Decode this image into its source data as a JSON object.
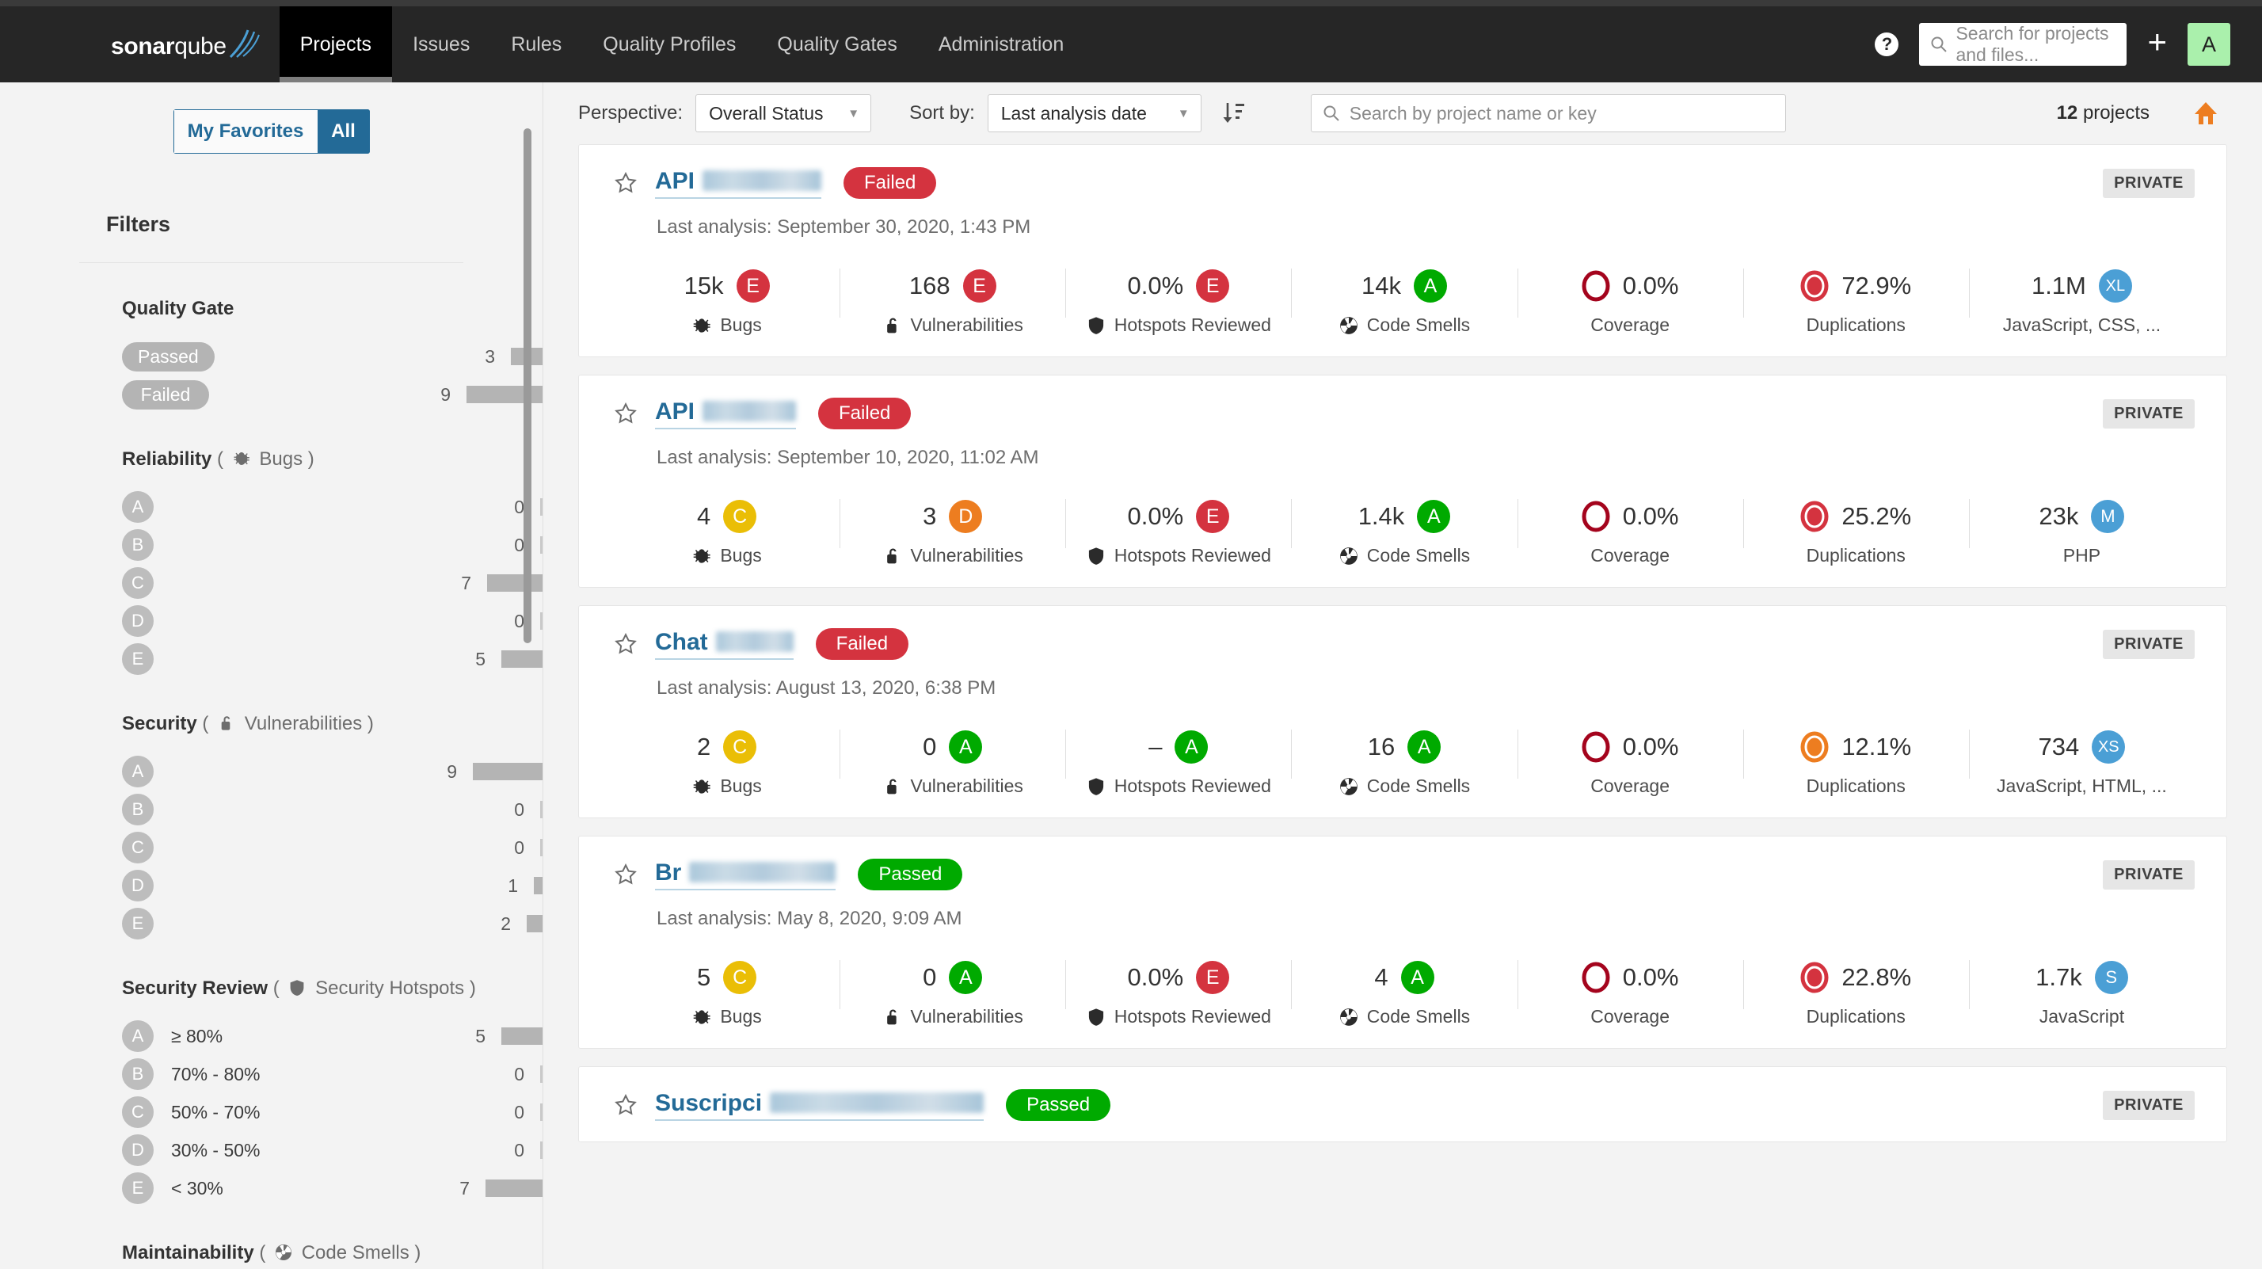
{
  "navbar": {
    "brand_bold": "sonar",
    "brand_light": "qube",
    "items": [
      {
        "label": "Projects",
        "active": true
      },
      {
        "label": "Issues",
        "active": false
      },
      {
        "label": "Rules",
        "active": false
      },
      {
        "label": "Quality Profiles",
        "active": false
      },
      {
        "label": "Quality Gates",
        "active": false
      },
      {
        "label": "Administration",
        "active": false
      }
    ],
    "help_label": "?",
    "search_placeholder": "Search for projects and files...",
    "plus_label": "+",
    "avatar_initial": "A"
  },
  "sidebar": {
    "favorites_label": "My Favorites",
    "all_label": "All",
    "filters_title": "Filters",
    "groups": [
      {
        "title": "Quality Gate",
        "sub": "",
        "icon": "",
        "type": "pill",
        "rows": [
          {
            "pill": "Passed",
            "count": "3",
            "bar": 40
          },
          {
            "pill": "Failed",
            "count": "9",
            "bar": 96
          }
        ]
      },
      {
        "title": "Reliability",
        "sub": "Bugs",
        "icon": "bug-icon",
        "type": "rating",
        "rows": [
          {
            "rating": "A",
            "label": "",
            "count": "0",
            "bar": 0
          },
          {
            "rating": "B",
            "label": "",
            "count": "0",
            "bar": 0
          },
          {
            "rating": "C",
            "label": "",
            "count": "7",
            "bar": 70
          },
          {
            "rating": "D",
            "label": "",
            "count": "0",
            "bar": 0
          },
          {
            "rating": "E",
            "label": "",
            "count": "5",
            "bar": 52
          }
        ]
      },
      {
        "title": "Security",
        "sub": "Vulnerabilities",
        "icon": "lock-icon",
        "type": "rating",
        "rows": [
          {
            "rating": "A",
            "label": "",
            "count": "9",
            "bar": 88
          },
          {
            "rating": "B",
            "label": "",
            "count": "0",
            "bar": 0
          },
          {
            "rating": "C",
            "label": "",
            "count": "0",
            "bar": 0
          },
          {
            "rating": "D",
            "label": "",
            "count": "1",
            "bar": 11
          },
          {
            "rating": "E",
            "label": "",
            "count": "2",
            "bar": 20
          }
        ]
      },
      {
        "title": "Security Review",
        "sub": "Security Hotspots",
        "icon": "shield-icon",
        "type": "rating",
        "rows": [
          {
            "rating": "A",
            "label": "≥ 80%",
            "count": "5",
            "bar": 52
          },
          {
            "rating": "B",
            "label": "70% - 80%",
            "count": "0",
            "bar": 0
          },
          {
            "rating": "C",
            "label": "50% - 70%",
            "count": "0",
            "bar": 0
          },
          {
            "rating": "D",
            "label": "30% - 50%",
            "count": "0",
            "bar": 0
          },
          {
            "rating": "E",
            "label": "< 30%",
            "count": "7",
            "bar": 72
          }
        ]
      },
      {
        "title": "Maintainability",
        "sub": "Code Smells",
        "icon": "code-smell-icon",
        "type": "rating",
        "rows": []
      }
    ]
  },
  "toolbar": {
    "perspective_label": "Perspective:",
    "perspective_value": "Overall Status",
    "sort_label": "Sort by:",
    "sort_value": "Last analysis date",
    "search_placeholder": "Search by project name or key",
    "count_number": "12",
    "count_word": "projects"
  },
  "cards": [
    {
      "name": "API",
      "redacted_width": 150,
      "status": "Failed",
      "status_kind": "failed",
      "visibility": "PRIVATE",
      "last_analysis": "Last analysis: September 30, 2020, 1:43 PM",
      "metrics": [
        {
          "value": "15k",
          "rating": "E",
          "color": "#d4333f",
          "label": "Bugs",
          "icon": "bug-icon"
        },
        {
          "value": "168",
          "rating": "E",
          "color": "#d4333f",
          "label": "Vulnerabilities",
          "icon": "lock-icon"
        },
        {
          "value": "0.0%",
          "rating": "E",
          "color": "#d4333f",
          "label": "Hotspots Reviewed",
          "icon": "shield-icon"
        },
        {
          "value": "14k",
          "rating": "A",
          "color": "#00aa00",
          "label": "Code Smells",
          "icon": "code-smell-icon"
        }
      ],
      "coverage": {
        "value": "0.0%",
        "label": "Coverage",
        "fill": 0,
        "color": "#a4041d"
      },
      "duplications": {
        "value": "72.9%",
        "label": "Duplications",
        "fill": 100,
        "color": "#d4333f"
      },
      "size": {
        "value": "1.1M",
        "badge": "XL",
        "langs": "JavaScript, CSS, ..."
      }
    },
    {
      "name": "API",
      "redacted_width": 118,
      "status": "Failed",
      "status_kind": "failed",
      "visibility": "PRIVATE",
      "last_analysis": "Last analysis: September 10, 2020, 11:02 AM",
      "metrics": [
        {
          "value": "4",
          "rating": "C",
          "color": "#eabe06",
          "label": "Bugs",
          "icon": "bug-icon"
        },
        {
          "value": "3",
          "rating": "D",
          "color": "#ed7d20",
          "label": "Vulnerabilities",
          "icon": "lock-icon"
        },
        {
          "value": "0.0%",
          "rating": "E",
          "color": "#d4333f",
          "label": "Hotspots Reviewed",
          "icon": "shield-icon"
        },
        {
          "value": "1.4k",
          "rating": "A",
          "color": "#00aa00",
          "label": "Code Smells",
          "icon": "code-smell-icon"
        }
      ],
      "coverage": {
        "value": "0.0%",
        "label": "Coverage",
        "fill": 0,
        "color": "#a4041d"
      },
      "duplications": {
        "value": "25.2%",
        "label": "Duplications",
        "fill": 100,
        "color": "#d4333f"
      },
      "size": {
        "value": "23k",
        "badge": "M",
        "langs": "PHP"
      }
    },
    {
      "name": "Chat",
      "redacted_width": 98,
      "status": "Failed",
      "status_kind": "failed",
      "visibility": "PRIVATE",
      "last_analysis": "Last analysis: August 13, 2020, 6:38 PM",
      "metrics": [
        {
          "value": "2",
          "rating": "C",
          "color": "#eabe06",
          "label": "Bugs",
          "icon": "bug-icon"
        },
        {
          "value": "0",
          "rating": "A",
          "color": "#00aa00",
          "label": "Vulnerabilities",
          "icon": "lock-icon"
        },
        {
          "value": "–",
          "rating": "A",
          "color": "#00aa00",
          "label": "Hotspots Reviewed",
          "icon": "shield-icon"
        },
        {
          "value": "16",
          "rating": "A",
          "color": "#00aa00",
          "label": "Code Smells",
          "icon": "code-smell-icon"
        }
      ],
      "coverage": {
        "value": "0.0%",
        "label": "Coverage",
        "fill": 0,
        "color": "#a4041d"
      },
      "duplications": {
        "value": "12.1%",
        "label": "Duplications",
        "fill": 100,
        "color": "#ed7d20"
      },
      "size": {
        "value": "734",
        "badge": "XS",
        "langs": "JavaScript, HTML, ..."
      }
    },
    {
      "name": "Br",
      "redacted_width": 185,
      "status": "Passed",
      "status_kind": "passed",
      "visibility": "PRIVATE",
      "last_analysis": "Last analysis: May 8, 2020, 9:09 AM",
      "metrics": [
        {
          "value": "5",
          "rating": "C",
          "color": "#eabe06",
          "label": "Bugs",
          "icon": "bug-icon"
        },
        {
          "value": "0",
          "rating": "A",
          "color": "#00aa00",
          "label": "Vulnerabilities",
          "icon": "lock-icon"
        },
        {
          "value": "0.0%",
          "rating": "E",
          "color": "#d4333f",
          "label": "Hotspots Reviewed",
          "icon": "shield-icon"
        },
        {
          "value": "4",
          "rating": "A",
          "color": "#00aa00",
          "label": "Code Smells",
          "icon": "code-smell-icon"
        }
      ],
      "coverage": {
        "value": "0.0%",
        "label": "Coverage",
        "fill": 0,
        "color": "#a4041d"
      },
      "duplications": {
        "value": "22.8%",
        "label": "Duplications",
        "fill": 100,
        "color": "#d4333f"
      },
      "size": {
        "value": "1.7k",
        "badge": "S",
        "langs": "JavaScript"
      }
    },
    {
      "name": "Suscripci",
      "redacted_width": 270,
      "status": "Passed",
      "status_kind": "passed",
      "visibility": "PRIVATE",
      "last_analysis": "",
      "metrics": [],
      "coverage": null,
      "duplications": null,
      "size": null
    }
  ]
}
